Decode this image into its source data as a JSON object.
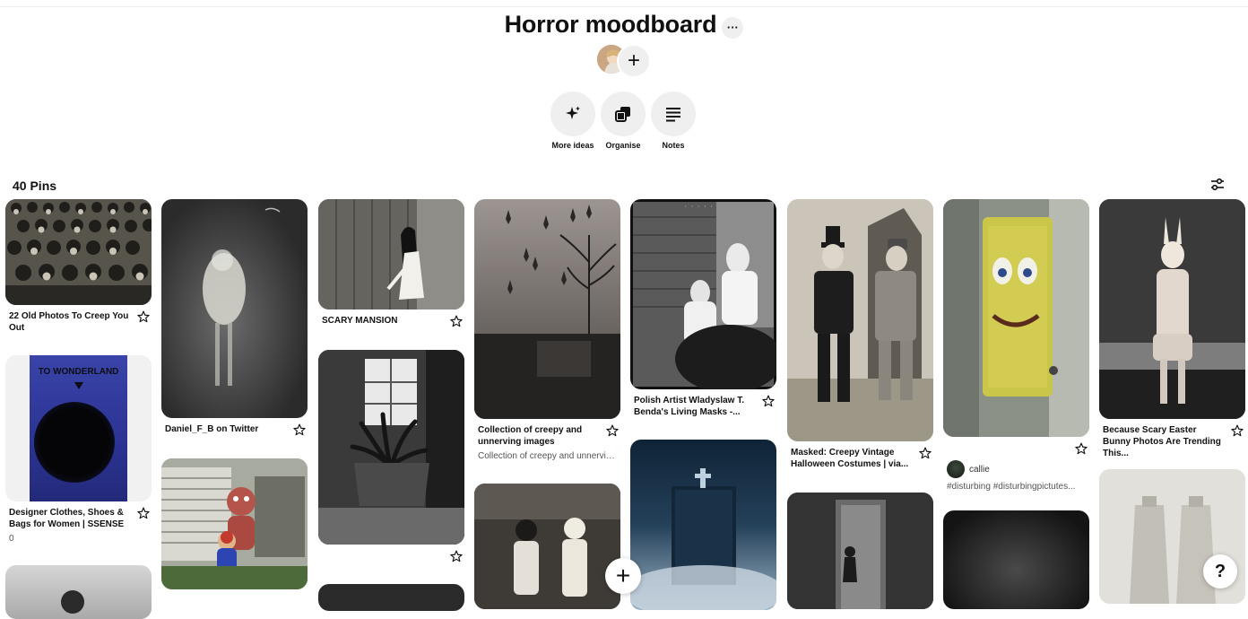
{
  "board": {
    "title": "Horror moodboard",
    "more_label": "···",
    "add_collaborator_label": "+"
  },
  "actions": [
    {
      "label": "More ideas",
      "icon": "sparkle-icon"
    },
    {
      "label": "Organise",
      "icon": "organise-icon"
    },
    {
      "label": "Notes",
      "icon": "notes-icon"
    }
  ],
  "pins_count": "40 Pins",
  "pins": {
    "p1": {
      "title": "22 Old Photos To Creep You Out"
    },
    "p2": {
      "title": "Designer Clothes, Shoes & Bags for Women | SSENSE",
      "count": "0",
      "image_text": "TO WONDERLAND"
    },
    "p3": {
      "title": "Daniel_F_B on Twitter"
    },
    "p4": {
      "title": "SCARY MANSION"
    },
    "p5": {
      "title": "Collection of creepy and unnerving images",
      "subtitle": "Collection of creepy and unnervin..."
    },
    "p6": {
      "title": "Polish Artist Wladyslaw T. Benda's Living Masks -..."
    },
    "p7": {
      "title": "Masked: Creepy Vintage Halloween Costumes | via..."
    },
    "p8": {
      "user": "callie",
      "subtitle": "#disturbing #disturbingpictutes..."
    },
    "p9": {
      "title": "Because Scary Easter Bunny Photos Are Trending This..."
    }
  },
  "fab": {
    "add_label": "+",
    "help_label": "?"
  },
  "colors": {
    "accent_bg": "#efefef",
    "text": "#111111"
  }
}
